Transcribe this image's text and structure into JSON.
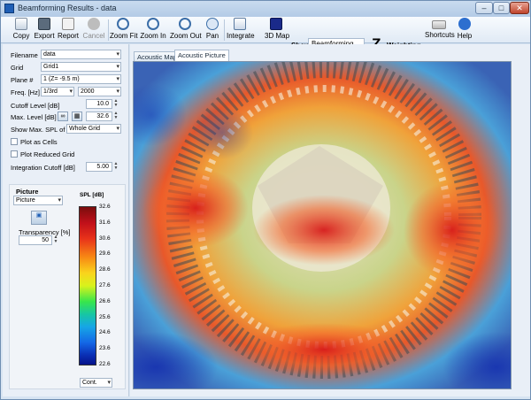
{
  "window": {
    "title": "Beamforming Results - data",
    "min": "–",
    "max": "□",
    "close": "✕"
  },
  "toolbar": {
    "copy": "Copy",
    "export": "Export",
    "report": "Report",
    "cancel": "Cancel",
    "zoom_fit": "Zoom Fit",
    "zoom_in": "Zoom In",
    "zoom_out": "Zoom Out",
    "pan": "Pan",
    "integrate": "Integrate",
    "map3d": "3D Map",
    "show_label": "Show",
    "show_value": "Beamforming",
    "z_glyph": "Z",
    "weighting": "Weighting",
    "shortcuts": "Shortcuts",
    "help": "Help"
  },
  "form": {
    "filename_label": "Filename",
    "filename": "data",
    "grid_label": "Grid",
    "grid": "Grid1",
    "plane_label": "Plane #",
    "plane": "1 (Z= -9.5 m)",
    "freq_label": "Freq. [Hz]",
    "freq_band": "1/3rd",
    "freq_value": "2000",
    "cutoff_label": "Cutoff Level [dB]",
    "cutoff": "10.0",
    "maxlevel_label": "Max. Level [dB]",
    "maxlevel": "32.6",
    "showmax_label": "Show Max. SPL of",
    "showmax": "Whole Grid",
    "plot_cells": "Plot as Cells",
    "plot_reduced": "Plot Reduced Grid",
    "integration_label": "Integration Cutoff [dB]",
    "integration": "5.00"
  },
  "picture": {
    "heading": "Picture",
    "mode": "Picture",
    "transparency_label": "Transparency [%]",
    "transparency": "50"
  },
  "colorbar": {
    "title": "SPL [dB]",
    "ticks": [
      "32.6",
      "31.6",
      "30.6",
      "29.6",
      "28.6",
      "27.6",
      "26.6",
      "25.6",
      "24.6",
      "23.6",
      "22.6"
    ],
    "mode": "Cont."
  },
  "tabs": [
    "Acoustic Map",
    "Acoustic Picture"
  ],
  "colors": {
    "accent": "#1f5fb5",
    "panel": "#e9eff7"
  }
}
